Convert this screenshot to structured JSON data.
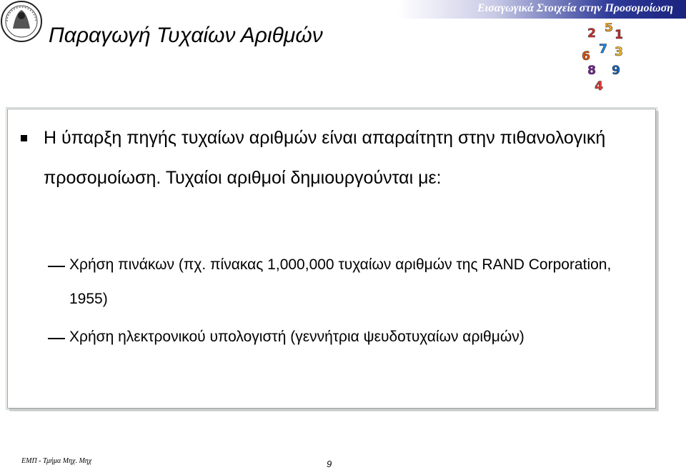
{
  "header": {
    "title": "Εισαγωγικά Στοιχεία στην Προσομοίωση"
  },
  "slide": {
    "title": "Παραγωγή Τυχαίων Αριθμών",
    "bullet": "Η ύπαρξη πηγής τυχαίων αριθμών είναι απαραίτητη στην πιθανολογική προσομοίωση. Τυχαίοι αριθμοί δημιουργούνται με:",
    "sub_items": [
      "Χρήση πινάκων (πχ. πίνακας 1,000,000 τυχαίων αριθμών της RAND Corporation, 1955)",
      "Χρήση ηλεκτρονικού υπολογιστή (γεννήτρια ψευδοτυχαίων αριθμών)"
    ]
  },
  "graphic": {
    "digits": [
      "2",
      "5",
      "1",
      "6",
      "7",
      "3",
      "8",
      "9",
      "4"
    ],
    "digit_colors": [
      "#d32f2f",
      "#f9a825",
      "#c62828",
      "#e65100",
      "#1e88e5",
      "#fbc02d",
      "#7b1fa2",
      "#1565c0",
      "#e53935"
    ]
  },
  "footer": {
    "left_text": "ΕΜΠ - Τμήμα Μηχ. Μηχ",
    "page_number": "9"
  },
  "colors": {
    "header_gradient_end": "#1a237e",
    "box_border": "#9aa0a6"
  }
}
